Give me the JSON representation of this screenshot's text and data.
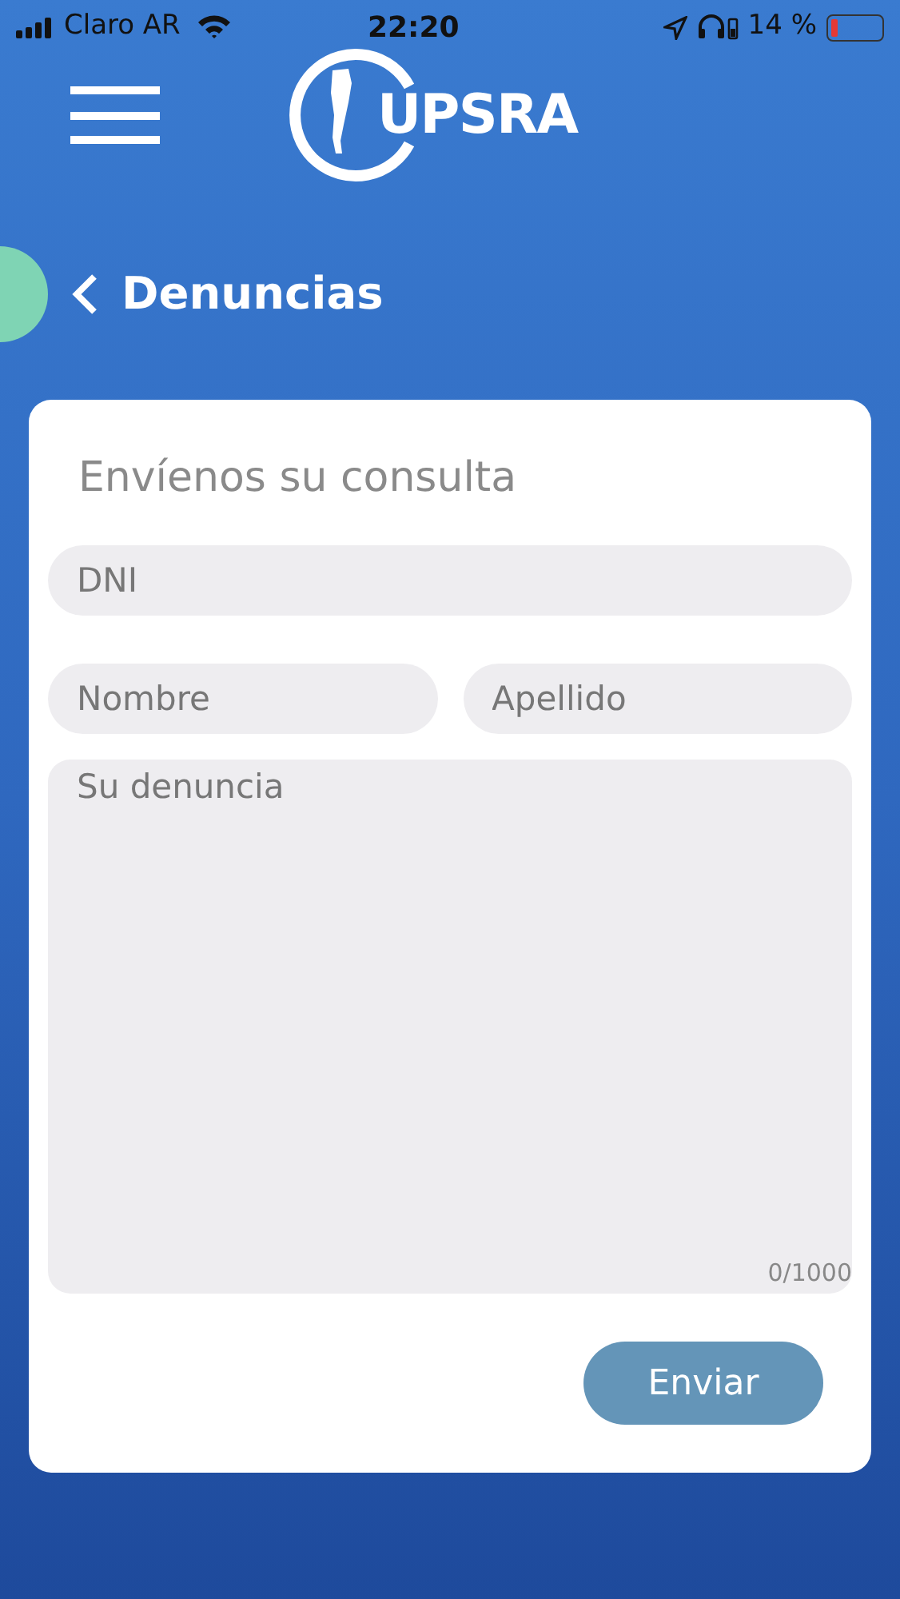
{
  "status_bar": {
    "carrier": "Claro AR",
    "time": "22:20",
    "battery_text": "14 %",
    "battery": {
      "level": 0.14
    }
  },
  "header": {
    "logo_text": "UPSRA"
  },
  "nav": {
    "back_label": "Denuncias"
  },
  "form": {
    "title": "Envíenos su consulta",
    "fields": [
      {
        "kind": "input",
        "placeholder": "DNI"
      },
      {
        "kind": "input",
        "placeholder": "Nombre"
      },
      {
        "kind": "input",
        "placeholder": "Apellido"
      },
      {
        "kind": "textarea",
        "placeholder": "Su denuncia",
        "counter": "0/1000"
      }
    ],
    "submit": "Enviar"
  }
}
